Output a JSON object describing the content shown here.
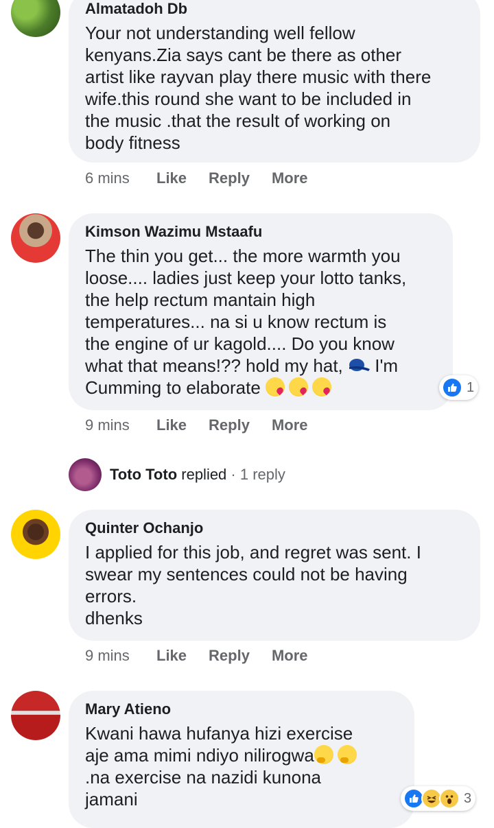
{
  "comments": [
    {
      "author": "Almatadoh Db",
      "text": "Your not understanding well fellow\nkenyans.Zia says cant be there as other\nartist like rayvan play there music with there\nwife.this round she want to be included in\nthe music .that the result of working on\nbody fitness",
      "time": "6 mins",
      "like": "Like",
      "reply": "Reply",
      "more": "More"
    },
    {
      "author": "Kimson Wazimu Mstaafu",
      "text_main": "The thin you get... the more warmth you\nloose.... ladies just keep your lotto tanks,\nthe help rectum mantain high\ntemperatures... na si u know rectum is\nthe engine of ur kagold.... Do you know\nwhat that means!?? hold my hat, ",
      "text_after_cap": " I'm\nCumming to elaborate ",
      "time": "9 mins",
      "like": "Like",
      "reply": "Reply",
      "more": "More",
      "reaction_count": "1"
    },
    {
      "author": "Quinter Ochanjo",
      "text": "I applied for this job, and regret was sent. I\nswear my sentences could not be having\nerrors.\ndhenks",
      "time": "9 mins",
      "like": "Like",
      "reply": "Reply",
      "more": "More"
    },
    {
      "author": "Mary Atieno",
      "text_main": "Kwani hawa hufanya hizi exercise\naje ama mimi ndiyo nilirogwa",
      "text_after": "\n.na exercise na nazidi kunona\njamani",
      "reaction_count": "3"
    }
  ],
  "replied": {
    "name": "Toto Toto",
    "verb": " replied",
    "count": " · 1 reply"
  },
  "colors": {
    "bubble": "#f0f2f5",
    "muted": "#65676b",
    "like_blue": "#1877f2"
  }
}
